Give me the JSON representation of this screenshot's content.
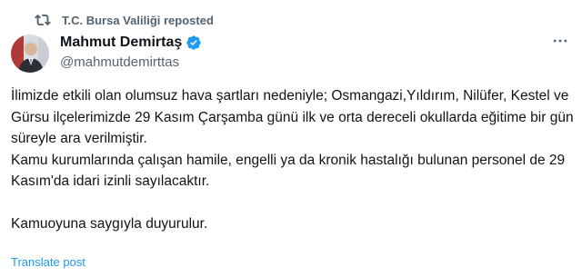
{
  "repost": {
    "label": "T.C. Bursa Valiliği reposted",
    "icon": "repost-icon"
  },
  "author": {
    "display_name": "Mahmut Demirtaş",
    "handle": "@mahmutdemirttas",
    "verified_icon": "verified-badge-icon",
    "verified_color": "#1d9bf0"
  },
  "menu": {
    "icon": "more-options-icon"
  },
  "tweet": {
    "paragraph_1": "İlimizde etkili olan olumsuz hava şartları nedeniyle; Osmangazi,Yıldırım, Nilüfer, Kestel ve Gürsu ilçelerimizde 29 Kasım Çarşamba günü ilk ve orta dereceli okullarda eğitime bir gün süreyle ara verilmiştir.",
    "paragraph_2": "Kamu kurumlarında çalışan hamile, engelli ya da kronik hastalığı bulunan personel de 29 Kasım'da idari izinli sayılacaktır.",
    "paragraph_3": "Kamuoyuna saygıyla duyurulur."
  },
  "translate": {
    "label": "Translate post",
    "color": "#1d9bf0"
  }
}
